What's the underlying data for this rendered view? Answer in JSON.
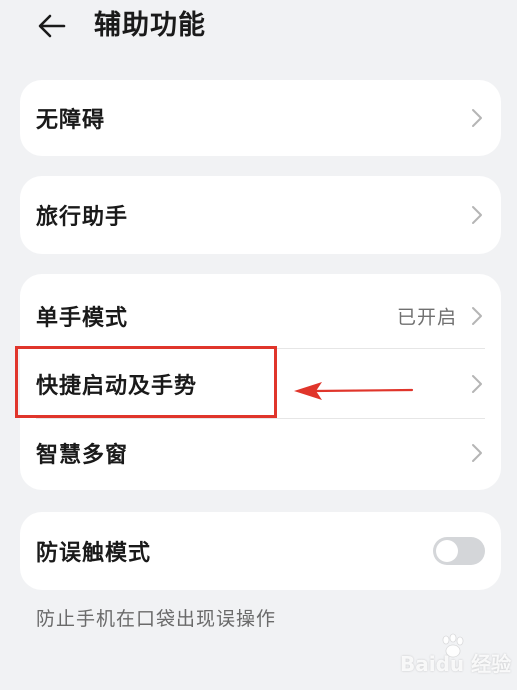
{
  "header": {
    "title": "辅助功能",
    "back_icon": "arrow-left-icon"
  },
  "cards": [
    {
      "label": "无障碍"
    },
    {
      "label": "旅行助手"
    },
    {
      "items": [
        {
          "label": "单手模式",
          "value": "已开启"
        },
        {
          "label": "快捷启动及手势"
        },
        {
          "label": "智慧多窗"
        }
      ]
    },
    {
      "label": "防误触模式",
      "toggle_on": false
    }
  ],
  "description": "防止手机在口袋出现误操作",
  "annotation": {
    "highlight_color": "#e0352b"
  },
  "watermark": {
    "text": "Baidu 经验"
  }
}
